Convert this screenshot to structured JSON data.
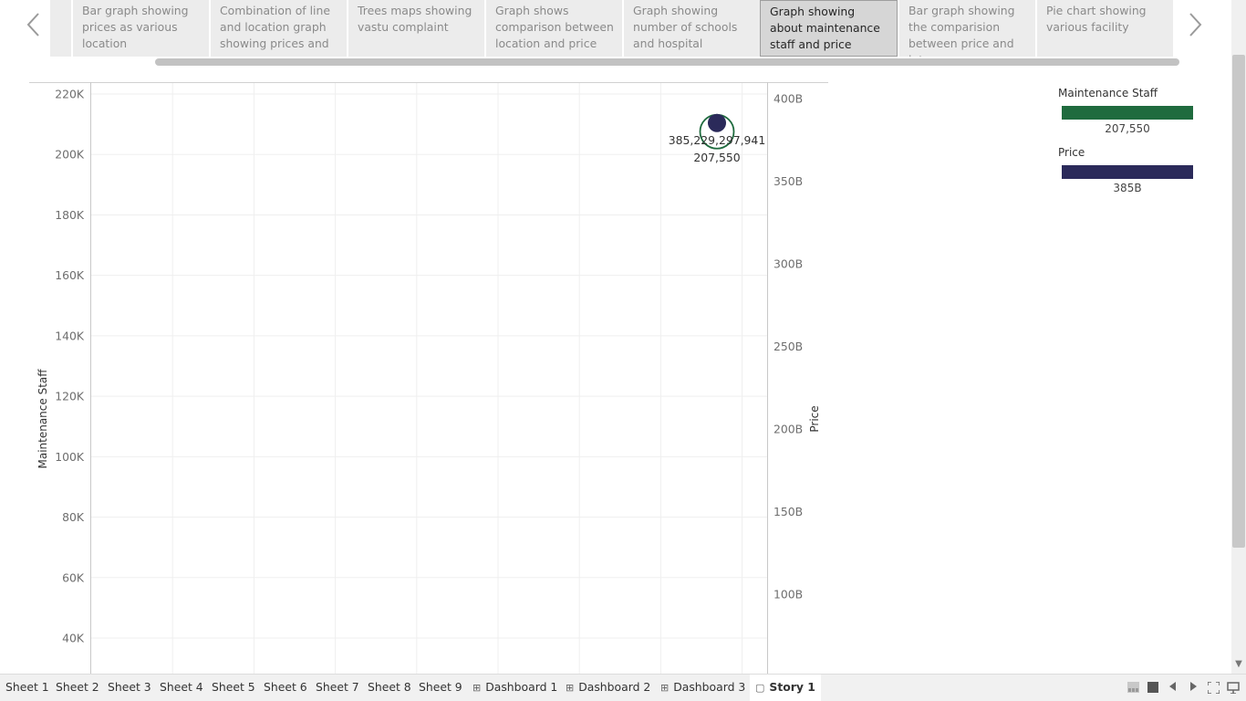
{
  "story": {
    "points": [
      {
        "label": ""
      },
      {
        "label": "Bar graph showing prices as various location"
      },
      {
        "label": "Combination of line and location graph showing prices and"
      },
      {
        "label": "Trees maps showing vastu complaint"
      },
      {
        "label": "Graph shows comparison between location and price"
      },
      {
        "label": "Graph showing number of schools and hospital"
      },
      {
        "label": "Graph showing about maintenance staff and price"
      },
      {
        "label": "Bar graph showing the comparision between price and intercom"
      },
      {
        "label": "Pie chart showing various facility"
      }
    ],
    "active_index": 6
  },
  "chart_data": {
    "type": "scatter",
    "title": "",
    "xlabel": "",
    "left_axis": {
      "label": "Maintenance Staff",
      "ticks": [
        "220K",
        "200K",
        "180K",
        "160K",
        "140K",
        "120K",
        "100K",
        "80K",
        "60K",
        "40K"
      ],
      "range": [
        30000,
        225000
      ]
    },
    "right_axis": {
      "label": "Price",
      "ticks": [
        "400B",
        "350B",
        "300B",
        "250B",
        "200B",
        "150B",
        "100B"
      ],
      "range": [
        70000000000,
        408000000000
      ]
    },
    "points": [
      {
        "series": "Maintenance Staff",
        "y": 207550,
        "axis": "left",
        "color": "#1f6b3e",
        "shape": "ring"
      },
      {
        "series": "Price",
        "y": 385229297941,
        "axis": "right",
        "color": "#2b2a5a",
        "shape": "dot"
      }
    ],
    "labels": [
      "385,229,297,941",
      "207,550"
    ],
    "grid": true,
    "legend_placement": "right"
  },
  "legend": {
    "items": [
      {
        "title": "Maintenance Staff",
        "value": "207,550",
        "color": "#1f6b3e"
      },
      {
        "title": "Price",
        "value": "385B",
        "color": "#2b2a5a"
      }
    ]
  },
  "tabs": [
    {
      "label": "Sheet 1",
      "icon": ""
    },
    {
      "label": "Sheet 2",
      "icon": ""
    },
    {
      "label": "Sheet 3",
      "icon": ""
    },
    {
      "label": "Sheet 4",
      "icon": ""
    },
    {
      "label": "Sheet 5",
      "icon": ""
    },
    {
      "label": "Sheet 6",
      "icon": ""
    },
    {
      "label": "Sheet 7",
      "icon": ""
    },
    {
      "label": "Sheet 8",
      "icon": ""
    },
    {
      "label": "Sheet 9",
      "icon": ""
    },
    {
      "label": "Dashboard 1",
      "icon": "dashboard-icon"
    },
    {
      "label": "Dashboard 2",
      "icon": "dashboard-icon"
    },
    {
      "label": "Dashboard 3",
      "icon": "dashboard-icon"
    },
    {
      "label": "Story 1",
      "icon": "story-icon"
    }
  ],
  "active_tab": "Story 1"
}
